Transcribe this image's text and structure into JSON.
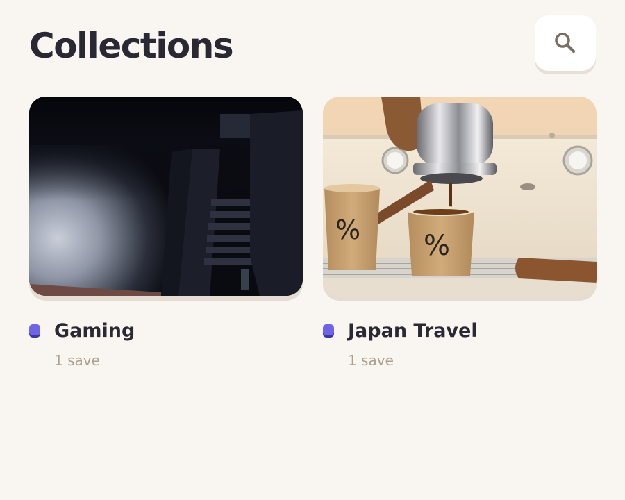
{
  "header": {
    "title": "Collections",
    "search_icon": "search-icon"
  },
  "colors": {
    "background": "#f9f6f2",
    "title_text": "#2a2933",
    "subtitle_text": "#ad9f8f",
    "accent_dot": "#6f63e6"
  },
  "collections": [
    {
      "name": "Gaming",
      "count": "1 save",
      "thumbnail": "dark corridor with flashlight beam"
    },
    {
      "name": "Japan Travel",
      "count": "1 save",
      "thumbnail": "espresso machine pouring into % cups"
    }
  ]
}
